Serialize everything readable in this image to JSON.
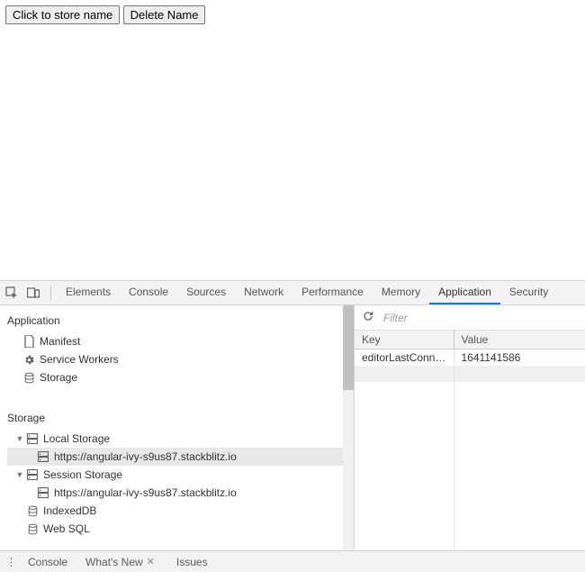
{
  "app": {
    "buttons": {
      "store": "Click to store name",
      "delete": "Delete Name"
    }
  },
  "devtools": {
    "tabs": [
      "Elements",
      "Console",
      "Sources",
      "Network",
      "Performance",
      "Memory",
      "Application",
      "Security"
    ],
    "active_tab": "Application",
    "left_sections": {
      "application": {
        "title": "Application",
        "items": [
          "Manifest",
          "Service Workers",
          "Storage"
        ]
      },
      "storage": {
        "title": "Storage",
        "local_storage": {
          "label": "Local Storage",
          "origins": [
            "https://angular-ivy-s9us87.stackblitz.io"
          ]
        },
        "session_storage": {
          "label": "Session Storage",
          "origins": [
            "https://angular-ivy-s9us87.stackblitz.io"
          ]
        },
        "indexeddb": "IndexedDB",
        "websql": "Web SQL"
      }
    },
    "filter_placeholder": "Filter",
    "kv": {
      "headers": {
        "key": "Key",
        "value": "Value"
      },
      "rows": [
        {
          "key": "editorLastConnec...",
          "value": "1641141586"
        }
      ]
    },
    "drawer": {
      "tabs": [
        "Console",
        "What's New",
        "Issues"
      ],
      "closable_index": 1
    }
  }
}
